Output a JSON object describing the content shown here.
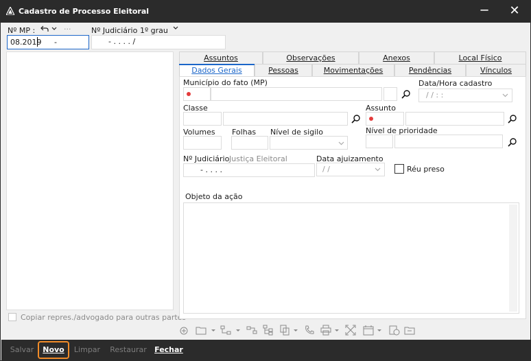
{
  "window": {
    "title": "Cadastro de Processo Eleitoral",
    "minimize": "─",
    "close": "✕"
  },
  "header": {
    "mp_label": "Nº MP :",
    "mp_value": "08.2019",
    "mp_mask": "-",
    "judicial_label": "Nº Judiciário",
    "judicial_degree": "1º grau",
    "judicial_mask": "- .   . . .   /",
    "more": "···"
  },
  "tabs_row1": [
    "Assuntos",
    "Observações",
    "Anexos",
    "Local Físico"
  ],
  "tabs_row2": [
    "Dados Gerais",
    "Pessoas",
    "Movimentações",
    "Pendências",
    "Vínculos"
  ],
  "form": {
    "municipio_label": "Município do fato (MP)",
    "datahora_label": "Data/Hora cadastro",
    "datahora_value": "/ /        : :",
    "classe_label": "Classe",
    "assunto_label": "Assunto",
    "volumes_label": "Volumes",
    "folhas_label": "Folhas",
    "sigilo_label": "Nível de sigilo",
    "prioridade_label": "Nível de prioridade",
    "judiciario_label": "Nº Judiciário",
    "justica_label": "Justiça Eleitoral",
    "judiciario_value": "- .   . . .",
    "ajuizamento_label": "Data ajuizamento",
    "ajuizamento_value": "/ /",
    "reu_preso_label": "Réu preso",
    "objeto_label": "Objeto da ação"
  },
  "left_panel": {
    "copy_label": "Copiar repres./advogado para outras partes"
  },
  "bottom": {
    "salvar": "Salvar",
    "novo": "Novo",
    "limpar": "Limpar",
    "restaurar": "Restaurar",
    "fechar": "Fechar"
  },
  "colors": {
    "titlebar": "#2b2b2b",
    "accent": "#1b66c9",
    "highlight": "#f28c28",
    "required_dot": "#e43b3b"
  },
  "icons": [
    "app-logo-icon",
    "undo-icon",
    "chevron-down-icon",
    "search-icon",
    "toolbar-add-icon",
    "folder-icon",
    "hierarchy-icon",
    "phone-icon",
    "print-icon",
    "expand-icon",
    "calendar-icon",
    "refresh-icon"
  ]
}
